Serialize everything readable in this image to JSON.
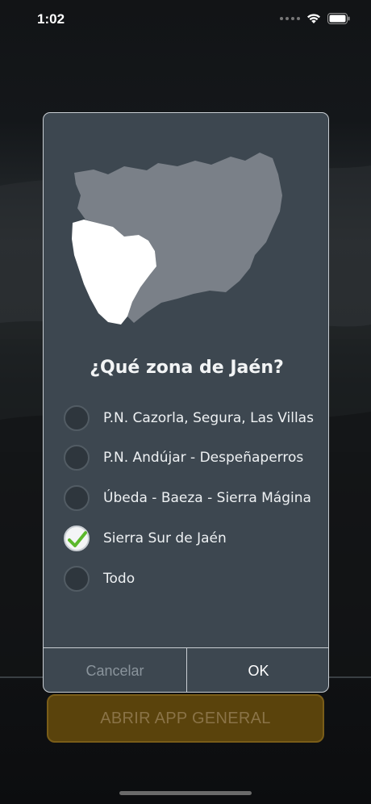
{
  "status_bar": {
    "time": "1:02",
    "icons": [
      "signal-dots-icon",
      "wifi-icon",
      "battery-icon"
    ]
  },
  "dialog": {
    "map": {
      "regions": [
        "map-region-rest",
        "map-region-sierra-sur-selected"
      ],
      "colors": {
        "selected": "#ffffff",
        "unselected": "#7a8088"
      }
    },
    "title": "¿Qué zona de Jaén?",
    "options": [
      {
        "label": "P.N. Cazorla, Segura, Las Villas",
        "checked": false
      },
      {
        "label": "P.N. Andújar - Despeñaperros",
        "checked": false
      },
      {
        "label": "Úbeda - Baeza - Sierra Mágina",
        "checked": false
      },
      {
        "label": "Sierra Sur de Jaén",
        "checked": true
      },
      {
        "label": "Todo",
        "checked": false
      }
    ],
    "cancel_label": "Cancelar",
    "ok_label": "OK"
  },
  "main": {
    "general_button_label": "ABRIR APP GENERAL"
  },
  "colors": {
    "dialog_bg": "#3d4750",
    "accent_button": "#5a430c",
    "check_green": "#5cb82c"
  }
}
